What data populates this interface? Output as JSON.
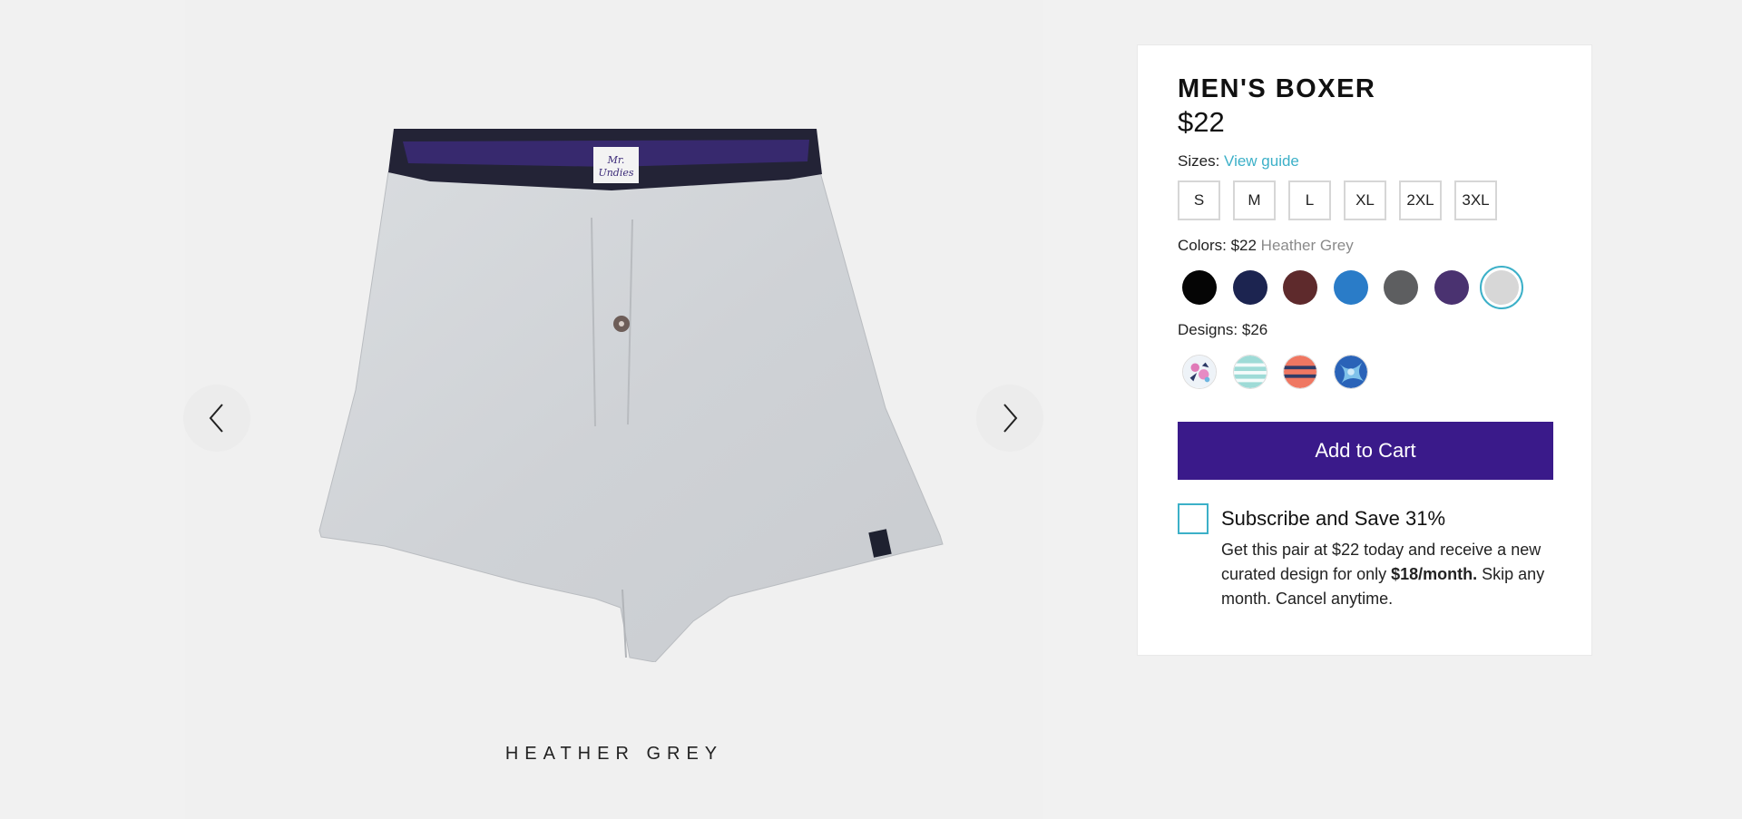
{
  "gallery": {
    "prev_icon": "chevron-left-icon",
    "next_icon": "chevron-right-icon",
    "caption": "HEATHER GREY",
    "waistband_brand": [
      "Mr.",
      "Undies"
    ]
  },
  "product": {
    "title": "MEN'S BOXER",
    "price": "$22"
  },
  "sizes": {
    "label": "Sizes:",
    "guide_link": "View guide",
    "options": [
      "S",
      "M",
      "L",
      "XL",
      "2XL",
      "3XL"
    ]
  },
  "colors": {
    "label": "Colors: $22",
    "selected_name": "Heather Grey",
    "swatches": [
      {
        "name": "black",
        "hex": "#050505"
      },
      {
        "name": "navy",
        "hex": "#1c2450"
      },
      {
        "name": "maroon",
        "hex": "#5e2a2c"
      },
      {
        "name": "blue",
        "hex": "#2a7cc8"
      },
      {
        "name": "charcoal",
        "hex": "#5d5e60"
      },
      {
        "name": "purple",
        "hex": "#4a3270"
      },
      {
        "name": "heather-grey",
        "hex": "#d7d7d7",
        "selected": true
      }
    ]
  },
  "designs": {
    "label": "Designs: $26",
    "items": [
      "floral-print",
      "aqua-stripe",
      "coral-stripe",
      "blue-tie-dye"
    ]
  },
  "cart": {
    "button_label": "Add to Cart",
    "button_color": "#3a1a8a"
  },
  "subscribe": {
    "title": "Subscribe and Save 31%",
    "desc_before": "Get this pair at $22 today and receive a new curated design for only ",
    "desc_bold": "$18/month.",
    "desc_after": " Skip any month. Cancel anytime."
  },
  "accent_color": "#3cb0c8"
}
